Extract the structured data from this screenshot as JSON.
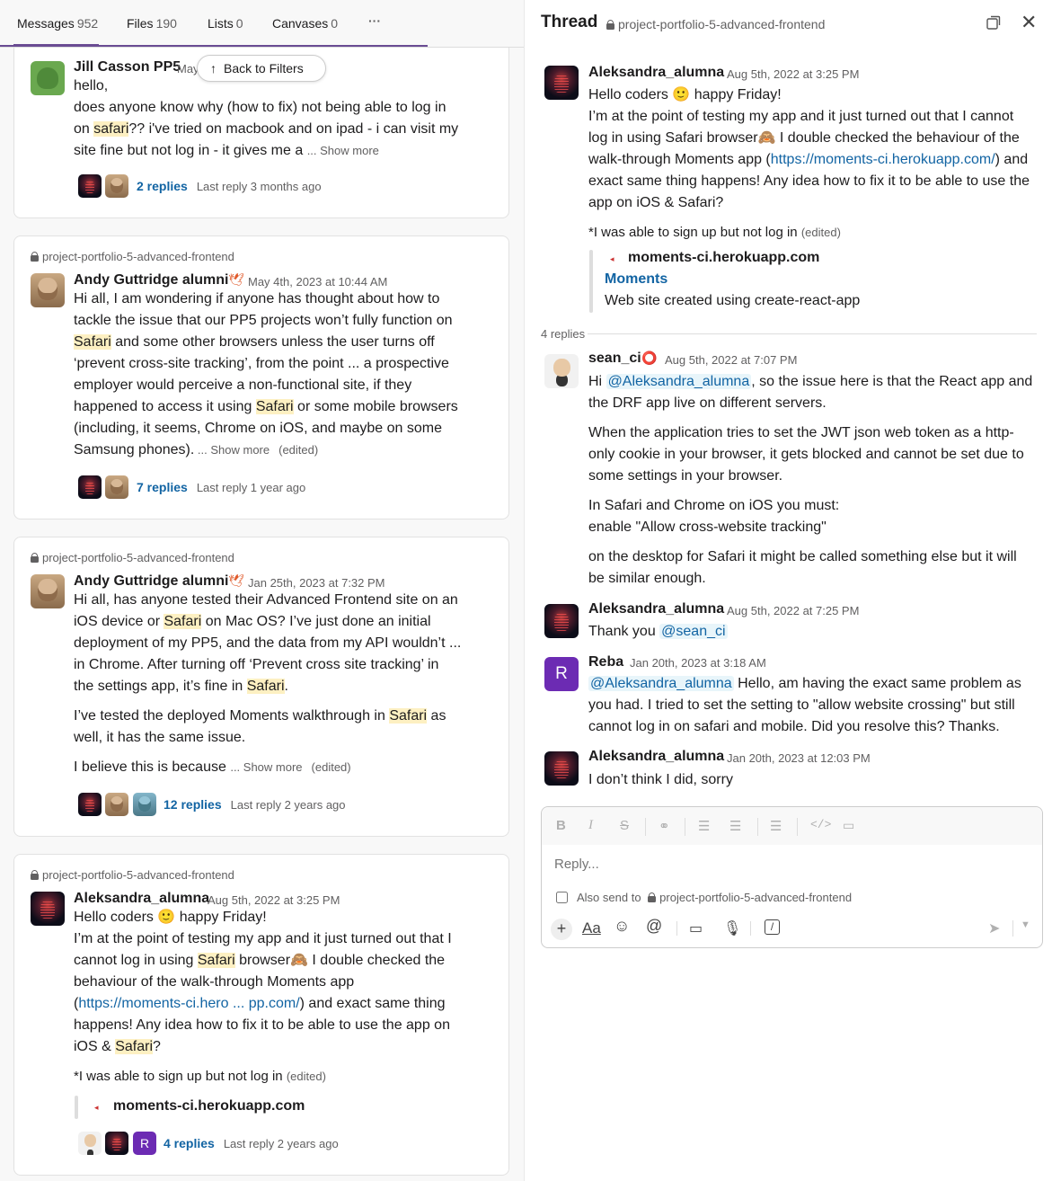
{
  "left": {
    "tabs": [
      {
        "label": "Messages",
        "count": "952"
      },
      {
        "label": "Files",
        "count": "190"
      },
      {
        "label": "Lists",
        "count": "0"
      },
      {
        "label": "Canvases",
        "count": "0"
      }
    ],
    "tabs_more": "···",
    "back_to_filters": "Back to Filters",
    "card0": {
      "name": "Jill Casson PP5",
      "ts": "May",
      "lines": [
        "hello,",
        "does anyone know why (how to fix) not being able to log in",
        "on ",
        "safari",
        "?? i've tried on macbook and on ipad - i can visit my",
        "site fine but not log in - it gives me a ",
        "... Show more"
      ],
      "replies": "2 replies",
      "last": "Last reply 3 months ago"
    },
    "card1": {
      "channel": "project-portfolio-5-advanced-frontend",
      "name": "Andy Guttridge alumni",
      "ts": "May 4th, 2023 at 10:44 AM",
      "line1": "Hi all, I am wondering if anyone has thought about how to",
      "line2": "tackle the issue that our PP5 projects won’t fully function on",
      "line3a": "Safari",
      "line3b": " and some other browsers unless the user turns off",
      "line4": "‘prevent cross-site tracking’, from the point ...  a prospective",
      "line5": "employer would perceive a non-functional site, if they",
      "line6a": "happened to access it using ",
      "line6b": "Safari",
      "line6c": " or some mobile browsers",
      "line7": "(including, it  seems, Chrome on iOS, and maybe on some",
      "line8": "Samsung phones).",
      "showmore": " ... Show more",
      "edited": "(edited)",
      "replies": "7 replies",
      "last": "Last reply 1 year ago"
    },
    "card2": {
      "channel": "project-portfolio-5-advanced-frontend",
      "name": "Andy Guttridge alumni",
      "ts": "Jan 25th, 2023 at 7:32 PM",
      "line1": "Hi all, has anyone tested their Advanced Frontend site on an",
      "line2a": "iOS device or ",
      "line2b": "Safari",
      "line2c": " on Mac OS? I’ve just done an initial",
      "line3": "deployment of my PP5, and the data from my API wouldn’t ...",
      "line4": "in Chrome. After turning off ‘Prevent cross site tracking’ in",
      "line5a": "the settings app, it’s fine in ",
      "line5b": "Safari",
      "line5c": ".",
      "line6a": "I’ve tested the deployed Moments walkthrough in ",
      "line6b": "Safari",
      "line6c": " as",
      "line7": "well, it has the same issue.",
      "line8": "I believe this is because ",
      "showmore": " ... Show more",
      "edited": "(edited)",
      "replies": "12 replies",
      "last": "Last reply 2 years ago"
    },
    "card3": {
      "channel": "project-portfolio-5-advanced-frontend",
      "name": "Aleksandra_alumna",
      "ts": "Aug 5th, 2022 at 3:25 PM",
      "line1a": "Hello coders ",
      "emoji1": "🙂",
      "line1b": " happy Friday!",
      "line2": "I’m at the point of testing my app and it just turned out that I",
      "line3a": "cannot log in using ",
      "line3b": "Safari",
      "line3c": " browser",
      "emoji2": "🙈",
      "line3d": " I double checked the",
      "line4": "behaviour of the walk-through Moments app",
      "line5a": "(",
      "line5b": "https://moments-ci.hero ...  pp.com/",
      "line5c": ") and exact same thing",
      "line6": "happens! Any idea how to fix it to be able to use the app on",
      "line7a": "iOS & ",
      "line7b": "Safari",
      "line7c": "?",
      "line8": "*I was able to sign up but not log in ",
      "edited": "(edited)",
      "unfurl": "moments-ci.herokuapp.com",
      "replies": "4 replies",
      "last": "Last reply 2 years ago"
    }
  },
  "thread": {
    "title": "Thread",
    "channel": "project-portfolio-5-advanced-frontend",
    "root": {
      "name": "Aleksandra_alumna",
      "ts": "Aug 5th, 2022 at 3:25 PM",
      "line1a": "Hello coders ",
      "emoji1": "🙂",
      "line1b": " happy Friday!",
      "line2": "I’m at the point of testing my app and it just turned out that I cannot",
      "line3a": "log in using Safari browser",
      "emoji2": "🙈",
      "line3b": " I double checked the behaviour of the",
      "line4a": "walk-through Moments app (",
      "line4b": "https://moments-ci.herokuapp.com/",
      "line4c": ") and",
      "line5": "exact same thing happens! Any idea how to fix it to be able to use the",
      "line6": "app on iOS & Safari?",
      "line7": "*I was able to sign up but not log in ",
      "edited": "(edited)",
      "unfurl_site": "moments-ci.herokuapp.com",
      "unfurl_title": "Moments",
      "unfurl_desc": "Web site created using create-react-app"
    },
    "replies_label": "4 replies",
    "reply1": {
      "name": "sean_ci",
      "ts": "Aug 5th, 2022 at 7:07 PM",
      "p1a": "Hi ",
      "p1mention": "@Aleksandra_alumna",
      "p1b": ", so the issue here is that the React app and",
      "p1c": "the DRF app live on different servers.",
      "p2a": "When the application tries to set the JWT json web token as a http-",
      "p2b": "only cookie in your browser, it gets blocked and cannot be set due to",
      "p2c": "some settings in your browser.",
      "p3a": "In Safari  and Chrome on iOS you must:",
      "p3b": "enable \"Allow cross-website tracking\"",
      "p4a": "on the desktop for Safari it might be called something else but it will",
      "p4b": "be similar enough."
    },
    "reply2": {
      "name": "Aleksandra_alumna",
      "ts": "Aug 5th, 2022 at 7:25 PM",
      "text": "Thank you ",
      "mention": "@sean_ci"
    },
    "reply3": {
      "name": "Reba",
      "avatar_letter": "R",
      "ts": "Jan 20th, 2023 at 3:18 AM",
      "mention": "@Aleksandra_alumna",
      "l1": " Hello, am having the exact same problem as",
      "l2": "you had. I tried to set the setting to \"allow website crossing\" but still",
      "l3": "cannot log in on safari and mobile. Did you resolve this? Thanks."
    },
    "reply4": {
      "name": "Aleksandra_alumna",
      "ts": "Jan 20th, 2023 at 12:03 PM",
      "text": "I don’t think I did, sorry"
    },
    "composer": {
      "placeholder": "Reply...",
      "also_send": "Also send to",
      "also_channel": "project-portfolio-5-advanced-frontend",
      "fmt": [
        "B",
        "I",
        "S"
      ]
    }
  },
  "colors": {
    "accent": "#6a4c93",
    "link": "#1264a3",
    "highlight": "#fdf0c2",
    "reba_avatar": "#6c2bb3"
  }
}
